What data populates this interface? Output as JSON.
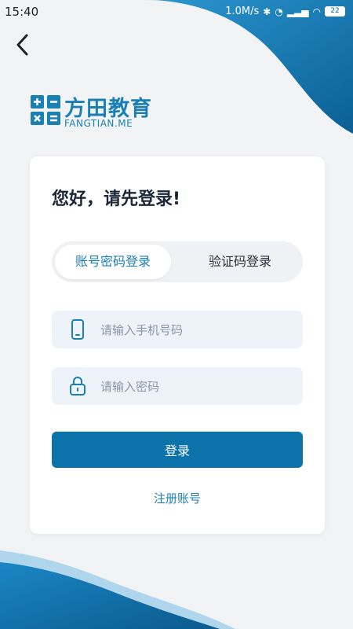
{
  "status_bar": {
    "time": "15:40",
    "network_speed": "1.0M/s",
    "battery_level": "22",
    "icons": [
      "bluetooth-icon",
      "mute-icon",
      "signal-icon",
      "wifi-icon",
      "battery-icon"
    ]
  },
  "header": {
    "back_icon": "chevron-left-icon"
  },
  "logo": {
    "name_cn": "方田教育",
    "domain": "FANGTIAN.ME"
  },
  "login_card": {
    "greeting": "您好，请先登录!",
    "tabs": [
      {
        "label": "账号密码登录",
        "active": true
      },
      {
        "label": "验证码登录",
        "active": false
      }
    ],
    "phone_field": {
      "placeholder": "请输入手机号码",
      "value": "",
      "icon": "phone-icon"
    },
    "password_field": {
      "placeholder": "请输入密码",
      "value": "",
      "icon": "lock-icon"
    },
    "submit_label": "登录",
    "register_label": "注册账号"
  },
  "colors": {
    "accent": "#0b73aa",
    "brand": "#1a7fb5",
    "background": "#f2f3f5"
  }
}
